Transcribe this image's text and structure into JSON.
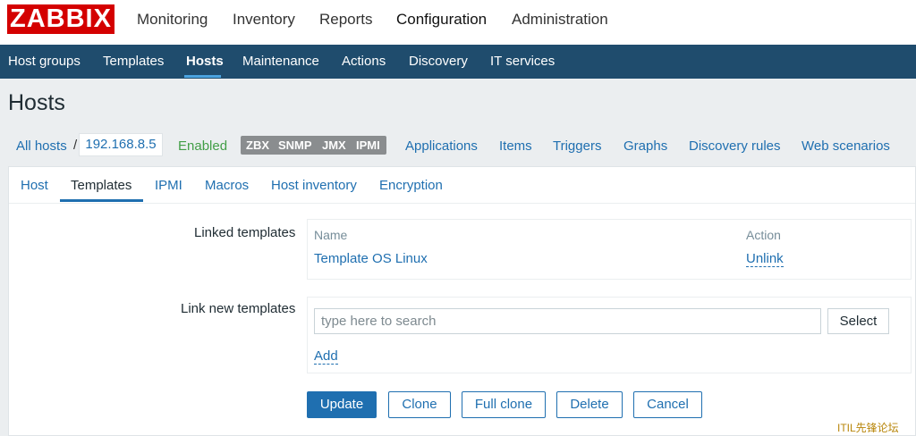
{
  "app": {
    "logo": "ZABBIX",
    "main_nav": [
      "Monitoring",
      "Inventory",
      "Reports",
      "Configuration",
      "Administration"
    ],
    "main_nav_active": "Configuration",
    "sub_nav": [
      "Host groups",
      "Templates",
      "Hosts",
      "Maintenance",
      "Actions",
      "Discovery",
      "IT services"
    ],
    "sub_nav_active": "Hosts"
  },
  "page": {
    "title": "Hosts"
  },
  "host_bar": {
    "all_hosts": "All hosts",
    "separator": "/",
    "host": "192.168.8.5",
    "status": "Enabled",
    "badges": [
      "ZBX",
      "SNMP",
      "JMX",
      "IPMI"
    ],
    "links": [
      "Applications",
      "Items",
      "Triggers",
      "Graphs",
      "Discovery rules",
      "Web scenarios"
    ]
  },
  "tabs": {
    "items": [
      "Host",
      "Templates",
      "IPMI",
      "Macros",
      "Host inventory",
      "Encryption"
    ],
    "active": "Templates"
  },
  "form": {
    "linked_templates_label": "Linked templates",
    "linked_table": {
      "columns": [
        "Name",
        "Action"
      ],
      "rows": [
        {
          "name": "Template OS Linux",
          "action": "Unlink"
        }
      ]
    },
    "link_new_label": "Link new templates",
    "search_placeholder": "type here to search",
    "select_button": "Select",
    "add_link": "Add"
  },
  "buttons": {
    "update": "Update",
    "clone": "Clone",
    "full_clone": "Full clone",
    "delete": "Delete",
    "cancel": "Cancel"
  },
  "watermark": "ITIL先锋论坛",
  "colors": {
    "logo": "#d40000",
    "subnav_bg": "#1f4c6d",
    "link": "#1f6fb0",
    "enabled": "#429e47",
    "badge_bg": "#8a8d8f"
  }
}
